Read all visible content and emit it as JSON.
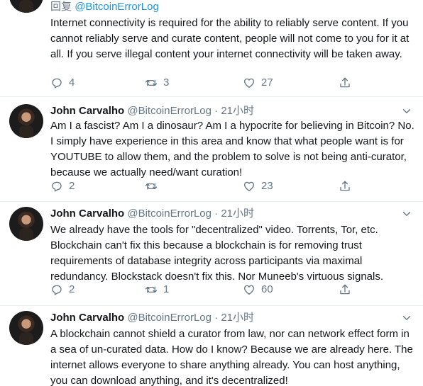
{
  "reply_context": {
    "prefix": "回复",
    "mention": "@BitcoinErrorLog"
  },
  "tweets": [
    {
      "name": "",
      "handle": "",
      "time": "",
      "text": "Internet connectivity is required for the ability to reliably serve content. If you cannot reliably serve and curate content, people will not come to you for it at all. If you serve illegal content your internet connectivity will be taken away.",
      "replies": "4",
      "retweets": "3",
      "likes": "27"
    },
    {
      "name": "John Carvalho",
      "handle": "@BitcoinErrorLog",
      "time": "21小时",
      "text": "Am I a fascist? Am I a dinosaur? Am I a hypocrite for believing in Bitcoin? No. I simply have experience in this area and know that what people want is for YOUTUBE to allow them, and the problem to solve is not being anti-curator, because we actually need/want curation!",
      "replies": "2",
      "retweets": "",
      "likes": "23"
    },
    {
      "name": "John Carvalho",
      "handle": "@BitcoinErrorLog",
      "time": "21小时",
      "text": "We already have the tools for \"decentralized\" video. Torrents, Tor, etc. Blockchain can't fix this because a blockchain is for removing trust requirements of database integrity across participants via maximal redundancy. Blockstack doesn't fix this. Nor Muneeb's virtuous signals.",
      "replies": "2",
      "retweets": "1",
      "likes": "60"
    },
    {
      "name": "John Carvalho",
      "handle": "@BitcoinErrorLog",
      "time": "21小时",
      "text": "A blockchain cannot shield a curator from law, nor can network effect form in a sea of un-curated data. How do I know? Because we are already here. The internet allows everyone to share anything already. You can host anything, you can download anything, and it's decentralized!"
    }
  ],
  "separator": "·",
  "colors": {
    "text": "#14171a",
    "secondary": "#657786",
    "link": "#1b95e0",
    "border": "#e6ecf0"
  }
}
